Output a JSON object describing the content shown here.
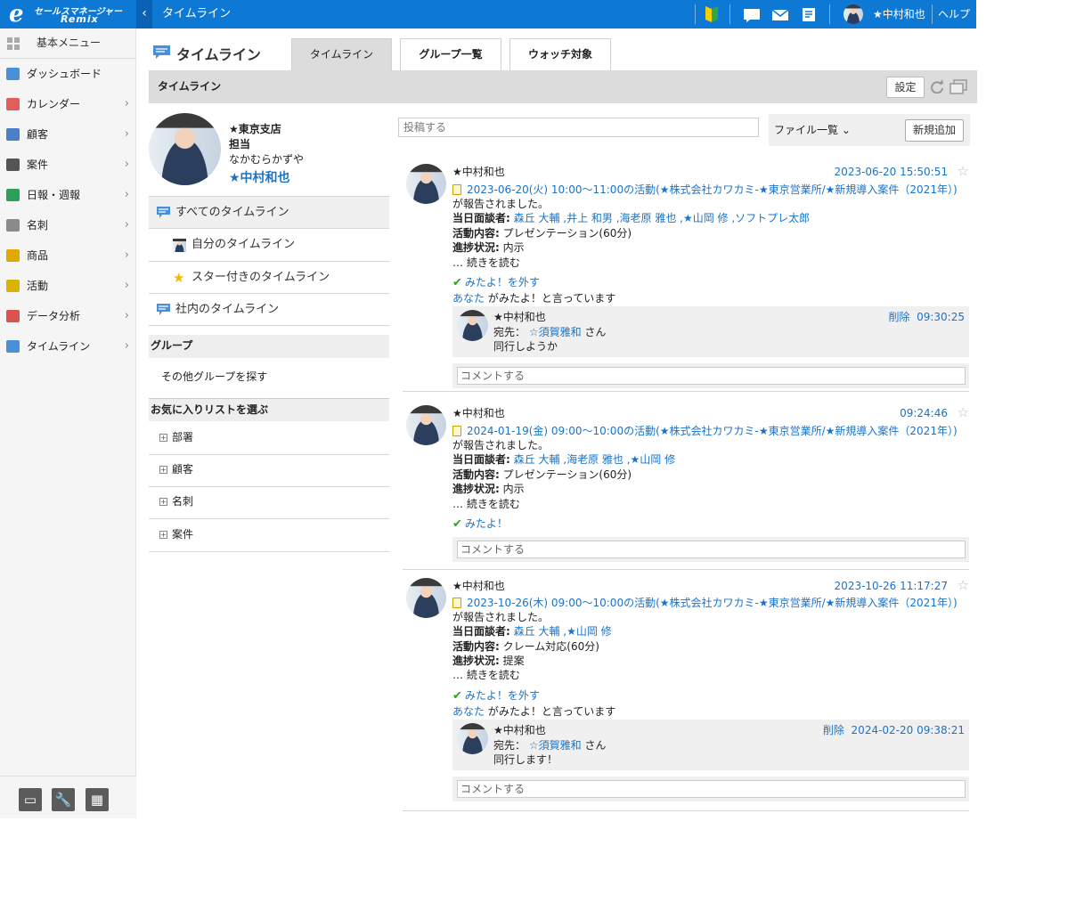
{
  "app": {
    "logo_line1": "セールスマネージャー",
    "logo_line2": "Remix",
    "logo_mark": "e",
    "title": "タイムライン",
    "user": "★中村和也",
    "help": "ヘルプ"
  },
  "sidebar": {
    "header": "基本メニュー",
    "items": [
      {
        "label": "ダッシュボード",
        "icon": "dashboard-icon",
        "color": "#4a90d9",
        "chevron": false
      },
      {
        "label": "カレンダー",
        "icon": "calendar-icon",
        "color": "#e25d5d",
        "chevron": true
      },
      {
        "label": "顧客",
        "icon": "building-icon",
        "color": "#4a7fc9",
        "chevron": true
      },
      {
        "label": "案件",
        "icon": "folder-icon",
        "color": "#555555",
        "chevron": true
      },
      {
        "label": "日報・週報",
        "icon": "report-icon",
        "color": "#2e9e5b",
        "chevron": true
      },
      {
        "label": "名刺",
        "icon": "card-icon",
        "color": "#8a8a8a",
        "chevron": true
      },
      {
        "label": "商品",
        "icon": "box-icon",
        "color": "#e0a800",
        "chevron": true
      },
      {
        "label": "活動",
        "icon": "clipboard-icon",
        "color": "#d9b300",
        "chevron": true
      },
      {
        "label": "データ分析",
        "icon": "chart-icon",
        "color": "#d9534f",
        "chevron": true
      },
      {
        "label": "タイムライン",
        "icon": "timeline-icon",
        "color": "#4a90d9",
        "chevron": true
      }
    ]
  },
  "main": {
    "page_title": "タイムライン",
    "tabs": [
      "タイムライン",
      "グループ一覧",
      "ウォッチ対象"
    ],
    "panel_title": "タイムライン",
    "settings": "設定"
  },
  "profile": {
    "branch": "★東京支店",
    "role": "担当",
    "kana": "なかむらかずや",
    "name": "★中村和也"
  },
  "timeline_menu": [
    "すべてのタイムライン",
    "自分のタイムライン",
    "スター付きのタイムライン",
    "社内のタイムライン"
  ],
  "groups": {
    "heading": "グループ",
    "find": "その他グループを探す"
  },
  "favorites": {
    "heading": "お気に入りリストを選ぶ",
    "items": [
      "部署",
      "顧客",
      "名刺",
      "案件"
    ]
  },
  "feed": {
    "post_placeholder": "投稿する",
    "file_list": "ファイル一覧",
    "add_new": "新規追加",
    "reported": "が報告されました。",
    "label_attendees": "当日面談者:",
    "label_content": "活動内容:",
    "label_progress": "進捗状況:",
    "read_more": "… 続きを読む",
    "comment_placeholder": "コメントする",
    "posts": [
      {
        "author": "★中村和也",
        "date": "2023-06-20 15:50:51",
        "activity": "2023-06-20(火) 10:00～11:00の活動(★株式会社カワカミ-★東京営業所/★新規導入案件（2021年）)",
        "attendees": "森丘 大輔 ,井上 和男 ,海老原 雅也 ,★山岡 修 ,ソフトプレ太郎",
        "content": "プレゼンテーション(60分)",
        "progress": "内示",
        "seen": "みたよ！を外す",
        "seen_by": "あなた",
        "seen_text": " がみたよ！と言っています",
        "reply": {
          "author": "★中村和也",
          "delete": "削除",
          "time": "09:30:25",
          "to_label": "宛先：",
          "to": "☆須賀雅和",
          "to_suffix": " さん",
          "text": "同行しようか"
        }
      },
      {
        "author": "★中村和也",
        "date": "09:24:46",
        "activity": "2024-01-19(金) 09:00～10:00の活動(★株式会社カワカミ-★東京営業所/★新規導入案件（2021年）)",
        "attendees": "森丘 大輔 ,海老原 雅也 ,★山岡 修",
        "content": "プレゼンテーション(60分)",
        "progress": "内示",
        "seen": "みたよ！"
      },
      {
        "author": "★中村和也",
        "date": "2023-10-26 11:17:27",
        "activity": "2023-10-26(木) 09:00～10:00の活動(★株式会社カワカミ-★東京営業所/★新規導入案件（2021年）)",
        "attendees": "森丘 大輔 ,★山岡 修",
        "content": "クレーム対応(60分)",
        "progress": "提案",
        "seen": "みたよ！を外す",
        "seen_by": "あなた",
        "seen_text": " がみたよ！と言っています",
        "reply": {
          "author": "★中村和也",
          "delete": "削除",
          "time": "2024-02-20 09:38:21",
          "to_label": "宛先：",
          "to": "☆須賀雅和",
          "to_suffix": " さん",
          "text": "同行します！"
        }
      }
    ]
  }
}
